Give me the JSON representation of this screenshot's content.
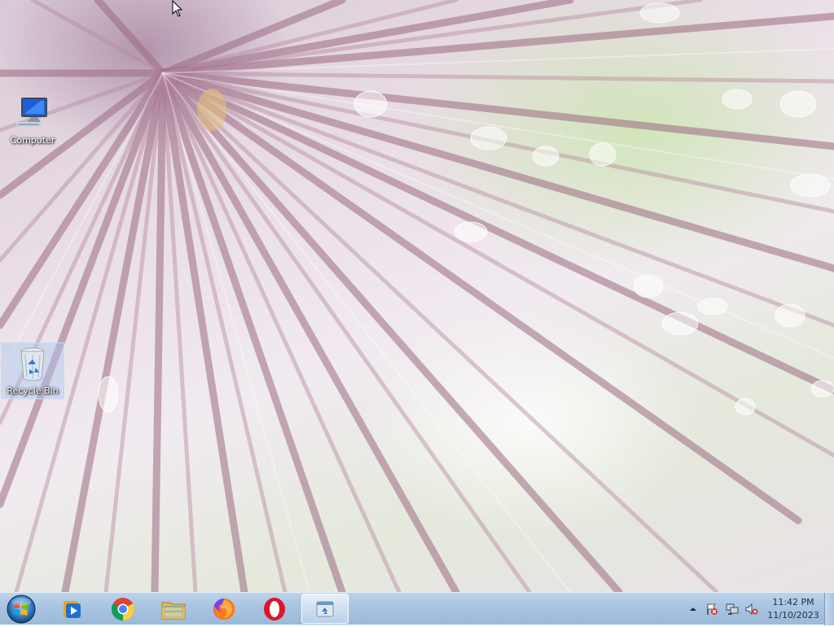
{
  "desktop": {
    "icons": [
      {
        "label": "Computer",
        "icon": "computer-icon",
        "selected": false
      },
      {
        "label": "Recycle Bin",
        "icon": "recycle-bin-icon",
        "selected": true
      }
    ]
  },
  "taskbar": {
    "start_icon": "windows-start-orb-icon",
    "pinned": [
      {
        "icon": "windows-media-player-icon",
        "active": false
      },
      {
        "icon": "chrome-icon",
        "active": false
      },
      {
        "icon": "file-explorer-icon",
        "active": false
      },
      {
        "icon": "firefox-icon",
        "active": false
      },
      {
        "icon": "opera-icon",
        "active": false
      },
      {
        "icon": "recycle-bin-window-icon",
        "active": true
      }
    ],
    "tray": {
      "icons": [
        "show-hidden-icons-arrow-icon",
        "action-center-flag-icon",
        "network-icon",
        "volume-muted-icon"
      ],
      "time": "11:42 PM",
      "date": "11/10/2023"
    }
  },
  "colors": {
    "taskbar": "#a9c4e0",
    "chrome_red": "#db4437",
    "opera_red": "#e0132b",
    "firefox_orange": "#ff7a1a"
  }
}
